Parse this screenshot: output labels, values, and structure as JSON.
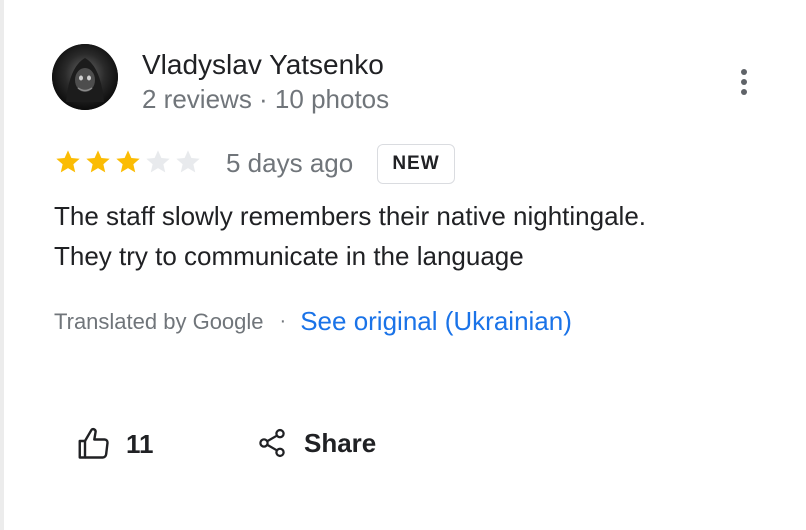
{
  "reviewer": {
    "name": "Vladyslav Yatsenko",
    "meta": "2 reviews · 10 photos",
    "avatar_icon": "avatar-photo"
  },
  "menu": {
    "icon": "more-vert-icon"
  },
  "rating": {
    "value": 3,
    "max": 5,
    "filled_color": "#fbbc04",
    "empty_color": "#e8eaed"
  },
  "review": {
    "date": "5 days ago",
    "badge": "NEW",
    "text_lines": [
      "The staff slowly remembers their native nightingale.",
      "They try to communicate in the language"
    ]
  },
  "translation": {
    "label": "Translated by Google",
    "separator": "·",
    "link": "See original (Ukrainian)",
    "link_color": "#1a73e8"
  },
  "actions": {
    "like_icon": "thumb-up-icon",
    "like_count": "11",
    "share_icon": "share-icon",
    "share_label": "Share"
  }
}
